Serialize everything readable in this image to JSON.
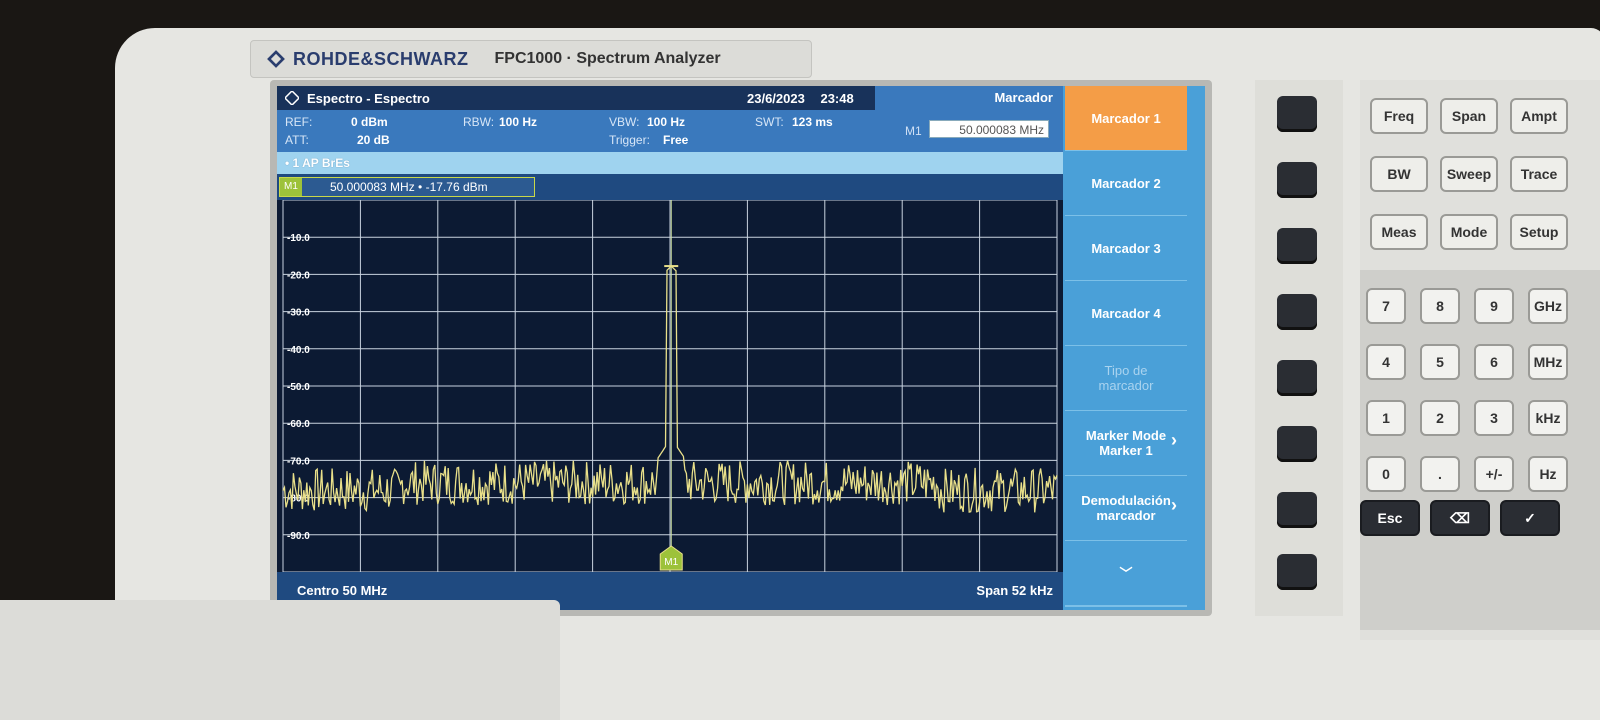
{
  "device": {
    "brand": "ROHDE&SCHWARZ",
    "model": "FPC1000 · Spectrum Analyzer"
  },
  "screen": {
    "title": "Espectro - Espectro",
    "date": "23/6/2023",
    "time": "23:48",
    "params": {
      "ref_label": "REF:",
      "ref_value": "0 dBm",
      "att_label": "ATT:",
      "att_value": "20 dB",
      "rbw_label": "RBW:",
      "rbw_value": "100 Hz",
      "vbw_label": "VBW:",
      "vbw_value": "100 Hz",
      "trigger_label": "Trigger:",
      "trigger_value": "Free",
      "swt_label": "SWT:",
      "swt_value": "123 ms"
    },
    "marker_panel_title": "Marcador",
    "marker_field_label": "M1",
    "marker_field_value": "50.000083 MHz",
    "trace_info": "• 1 AP  BrEs",
    "readout": {
      "tag": "M1",
      "text": "50.000083 MHz  •  -17.76 dBm"
    },
    "center": "Centro 50 MHz",
    "span": "Span 52 kHz",
    "softkeys": [
      {
        "label": "Marcador 1",
        "active": true
      },
      {
        "label": "Marcador 2"
      },
      {
        "label": "Marcador 3"
      },
      {
        "label": "Marcador 4"
      },
      {
        "label": "Tipo de\nmarcador",
        "dim": true
      },
      {
        "label": "Marker Mode\nMarker 1"
      },
      {
        "label": "Demodulación\nmarcador"
      },
      {
        "label": "﹀"
      }
    ]
  },
  "chart_data": {
    "type": "line",
    "y_tick_labels": [
      "-10.0",
      "-20.0",
      "-30.0",
      "-40.0",
      "-50.0",
      "-60.0",
      "-70.0",
      "-80.0",
      "-90.0"
    ],
    "ylim": [
      -100,
      0
    ],
    "xlim_khz_offset": [
      -26,
      26
    ],
    "series": [
      {
        "color": "#e9e08a",
        "peak": {
          "offset_khz": 0.083,
          "level_dbm": -17.76
        },
        "noise_floor_dbm": -76
      }
    ],
    "marker": {
      "name": "M1",
      "offset_khz": 0.083,
      "level_dbm": -17.76
    }
  },
  "keypad": {
    "row1": [
      "Freq",
      "Span",
      "Ampt"
    ],
    "row2": [
      "BW",
      "Sweep",
      "Trace"
    ],
    "row3": [
      "Meas",
      "Mode",
      "Setup"
    ],
    "num": [
      [
        "7",
        "8",
        "9",
        "GHz"
      ],
      [
        "4",
        "5",
        "6",
        "MHz"
      ],
      [
        "1",
        "2",
        "3",
        "kHz"
      ],
      [
        "0",
        ".",
        "+/-",
        "Hz"
      ]
    ],
    "bottom": [
      "Esc",
      "⌫",
      "✓"
    ]
  },
  "colors": {
    "accent": "#f49d47",
    "softkey": "#4aa0d8",
    "trace": "#e9e08a"
  }
}
